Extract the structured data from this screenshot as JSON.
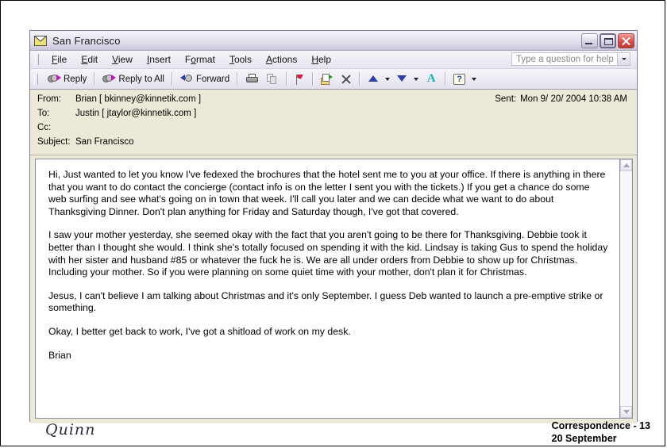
{
  "window": {
    "title": "San Francisco",
    "icon": "envelope-icon",
    "controls": {
      "minimize": "Minimize",
      "maximize": "Maximize",
      "close": "Close"
    }
  },
  "menu": {
    "items": [
      {
        "label": "File",
        "accel": "F"
      },
      {
        "label": "Edit",
        "accel": "E"
      },
      {
        "label": "View",
        "accel": "V"
      },
      {
        "label": "Insert",
        "accel": "I"
      },
      {
        "label": "Format",
        "accel": "o"
      },
      {
        "label": "Tools",
        "accel": "T"
      },
      {
        "label": "Actions",
        "accel": "A"
      },
      {
        "label": "Help",
        "accel": "H"
      }
    ],
    "help_box": {
      "placeholder": "Type a question for help",
      "value": ""
    }
  },
  "toolbar": {
    "reply": "Reply",
    "reply_all": "Reply to All",
    "forward": "Forward",
    "print": "",
    "copy": "",
    "flag": "",
    "move_to_folder": "",
    "delete": "",
    "previous": "",
    "next": "",
    "autoformat": "",
    "help": "?"
  },
  "headers": {
    "from_label": "From:",
    "from_value": "Brian [ bkinney@kinnetik.com ]",
    "to_label": "To:",
    "to_value": "Justin [ jtaylor@kinnetik.com ]",
    "cc_label": "Cc:",
    "cc_value": "",
    "subject_label": "Subject:",
    "subject_value": "San Francisco",
    "sent_label": "Sent:",
    "sent_value": "Mon 9/ 20/ 2004 10:38 AM"
  },
  "body": {
    "paragraphs": [
      "Hi, Just wanted to let you know I've fedexed the brochures that the hotel sent me to you at your office. If there is anything in  there that you want to do contact the concierge   (contact info is on the letter I sent you with the tickets.) If you get a chance do some web surfing and see what's going on in town that week. I'll call you later and we can decide what we want to do about Thanksgiving Dinner. Don't plan anything for Friday and Saturday though, I've got that covered.",
      "I saw your mother yesterday, she seemed okay with the fact that you aren't going to be there for Thanksgiving. Debbie took it better than I thought she would. I think she's totally focused on spending it with the kid. Lindsay is taking Gus to spend the holiday with her sister and husband #85 or whatever the fuck he is. We are all under orders from Debbie to show up for Christmas. Including your mother. So if you were planning on some quiet time with your mother, don't plan it for Christmas.",
      "Jesus, I can't believe I am talking about Christmas and it's only September. I guess Deb wanted to launch a pre-emptive strike or something.",
      "Okay, I better get back to work, I've got a shitload of work on my desk.",
      "Brian"
    ]
  },
  "footer": {
    "signature": "Quinn",
    "correspondence": "Correspondence - 13",
    "date": "20 September"
  }
}
